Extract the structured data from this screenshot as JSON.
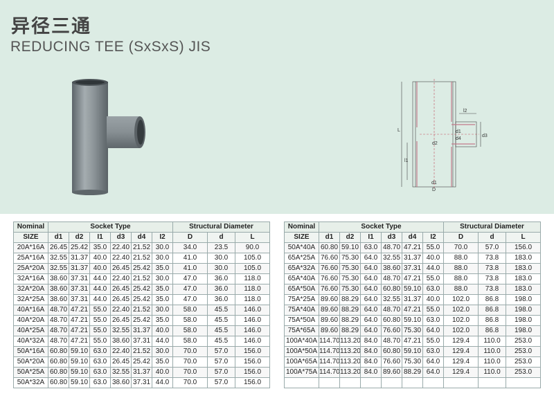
{
  "header": {
    "title_cn": "异径三通",
    "title_en": "REDUCING TEE (SxSxS) JIS"
  },
  "drawing_labels": {
    "l2": "l2",
    "d1_left": "d1",
    "d4": "d4",
    "d3": "d3",
    "d2": "d2",
    "L": "L",
    "l1": "l1",
    "d1_bottom": "d1",
    "D": "D"
  },
  "table_headers": {
    "nominal": "Nominal",
    "socket_type": "Socket Type",
    "structural_diameter": "Structural Diameter",
    "size": "SIZE",
    "d1": "d1",
    "d2": "d2",
    "i1": "I1",
    "d3": "d3",
    "d4": "d4",
    "i2": "I2",
    "D": "D",
    "d": "d",
    "L": "L"
  },
  "left_table": [
    [
      "20A*16A",
      "26.45",
      "25.42",
      "35.0",
      "22.40",
      "21.52",
      "30.0",
      "34.0",
      "23.5",
      "90.0"
    ],
    [
      "25A*16A",
      "32.55",
      "31.37",
      "40.0",
      "22.40",
      "21.52",
      "30.0",
      "41.0",
      "30.0",
      "105.0"
    ],
    [
      "25A*20A",
      "32.55",
      "31.37",
      "40.0",
      "26.45",
      "25.42",
      "35.0",
      "41.0",
      "30.0",
      "105.0"
    ],
    [
      "32A*16A",
      "38.60",
      "37.31",
      "44.0",
      "22.40",
      "21.52",
      "30.0",
      "47.0",
      "36.0",
      "118.0"
    ],
    [
      "32A*20A",
      "38.60",
      "37.31",
      "44.0",
      "26.45",
      "25.42",
      "35.0",
      "47.0",
      "36.0",
      "118.0"
    ],
    [
      "32A*25A",
      "38.60",
      "37.31",
      "44.0",
      "26.45",
      "25.42",
      "35.0",
      "47.0",
      "36.0",
      "118.0"
    ],
    [
      "40A*16A",
      "48.70",
      "47.21",
      "55.0",
      "22.40",
      "21.52",
      "30.0",
      "58.0",
      "45.5",
      "146.0"
    ],
    [
      "40A*20A",
      "48.70",
      "47.21",
      "55.0",
      "26.45",
      "25.42",
      "35.0",
      "58.0",
      "45.5",
      "146.0"
    ],
    [
      "40A*25A",
      "48.70",
      "47.21",
      "55.0",
      "32.55",
      "31.37",
      "40.0",
      "58.0",
      "45.5",
      "146.0"
    ],
    [
      "40A*32A",
      "48.70",
      "47.21",
      "55.0",
      "38.60",
      "37.31",
      "44.0",
      "58.0",
      "45.5",
      "146.0"
    ],
    [
      "50A*16A",
      "60.80",
      "59.10",
      "63.0",
      "22.40",
      "21.52",
      "30.0",
      "70.0",
      "57.0",
      "156.0"
    ],
    [
      "50A*20A",
      "60.80",
      "59.10",
      "63.0",
      "26.45",
      "25.42",
      "35.0",
      "70.0",
      "57.0",
      "156.0"
    ],
    [
      "50A*25A",
      "60.80",
      "59.10",
      "63.0",
      "32.55",
      "31.37",
      "40.0",
      "70.0",
      "57.0",
      "156.0"
    ],
    [
      "50A*32A",
      "60.80",
      "59.10",
      "63.0",
      "38.60",
      "37.31",
      "44.0",
      "70.0",
      "57.0",
      "156.0"
    ]
  ],
  "right_table": [
    [
      "50A*40A",
      "60.80",
      "59.10",
      "63.0",
      "48.70",
      "47.21",
      "55.0",
      "70.0",
      "57.0",
      "156.0"
    ],
    [
      "65A*25A",
      "76.60",
      "75.30",
      "64.0",
      "32.55",
      "31.37",
      "40.0",
      "88.0",
      "73.8",
      "183.0"
    ],
    [
      "65A*32A",
      "76.60",
      "75.30",
      "64.0",
      "38.60",
      "37.31",
      "44.0",
      "88.0",
      "73.8",
      "183.0"
    ],
    [
      "65A*40A",
      "76.60",
      "75.30",
      "64.0",
      "48.70",
      "47.21",
      "55.0",
      "88.0",
      "73.8",
      "183.0"
    ],
    [
      "65A*50A",
      "76.60",
      "75.30",
      "64.0",
      "60.80",
      "59.10",
      "63.0",
      "88.0",
      "73.8",
      "183.0"
    ],
    [
      "75A*25A",
      "89.60",
      "88.29",
      "64.0",
      "32.55",
      "31.37",
      "40.0",
      "102.0",
      "86.8",
      "198.0"
    ],
    [
      "75A*40A",
      "89.60",
      "88.29",
      "64.0",
      "48.70",
      "47.21",
      "55.0",
      "102.0",
      "86.8",
      "198.0"
    ],
    [
      "75A*50A",
      "89.60",
      "88.29",
      "64.0",
      "60.80",
      "59.10",
      "63.0",
      "102.0",
      "86.8",
      "198.0"
    ],
    [
      "75A*65A",
      "89.60",
      "88.29",
      "64.0",
      "76.60",
      "75.30",
      "64.0",
      "102.0",
      "86.8",
      "198.0"
    ],
    [
      "100A*40A",
      "114.70",
      "113.20",
      "84.0",
      "48.70",
      "47.21",
      "55.0",
      "129.4",
      "110.0",
      "253.0"
    ],
    [
      "100A*50A",
      "114.70",
      "113.20",
      "84.0",
      "60.80",
      "59.10",
      "63.0",
      "129.4",
      "110.0",
      "253.0"
    ],
    [
      "100A*65A",
      "114.70",
      "113.20",
      "84.0",
      "76.60",
      "75.30",
      "64.0",
      "129.4",
      "110.0",
      "253.0"
    ],
    [
      "100A*75A",
      "114.70",
      "113.20",
      "84.0",
      "89.60",
      "88.29",
      "64.0",
      "129.4",
      "110.0",
      "253.0"
    ],
    [
      "",
      "",
      "",
      "",
      "",
      "",
      "",
      "",
      "",
      ""
    ]
  ]
}
